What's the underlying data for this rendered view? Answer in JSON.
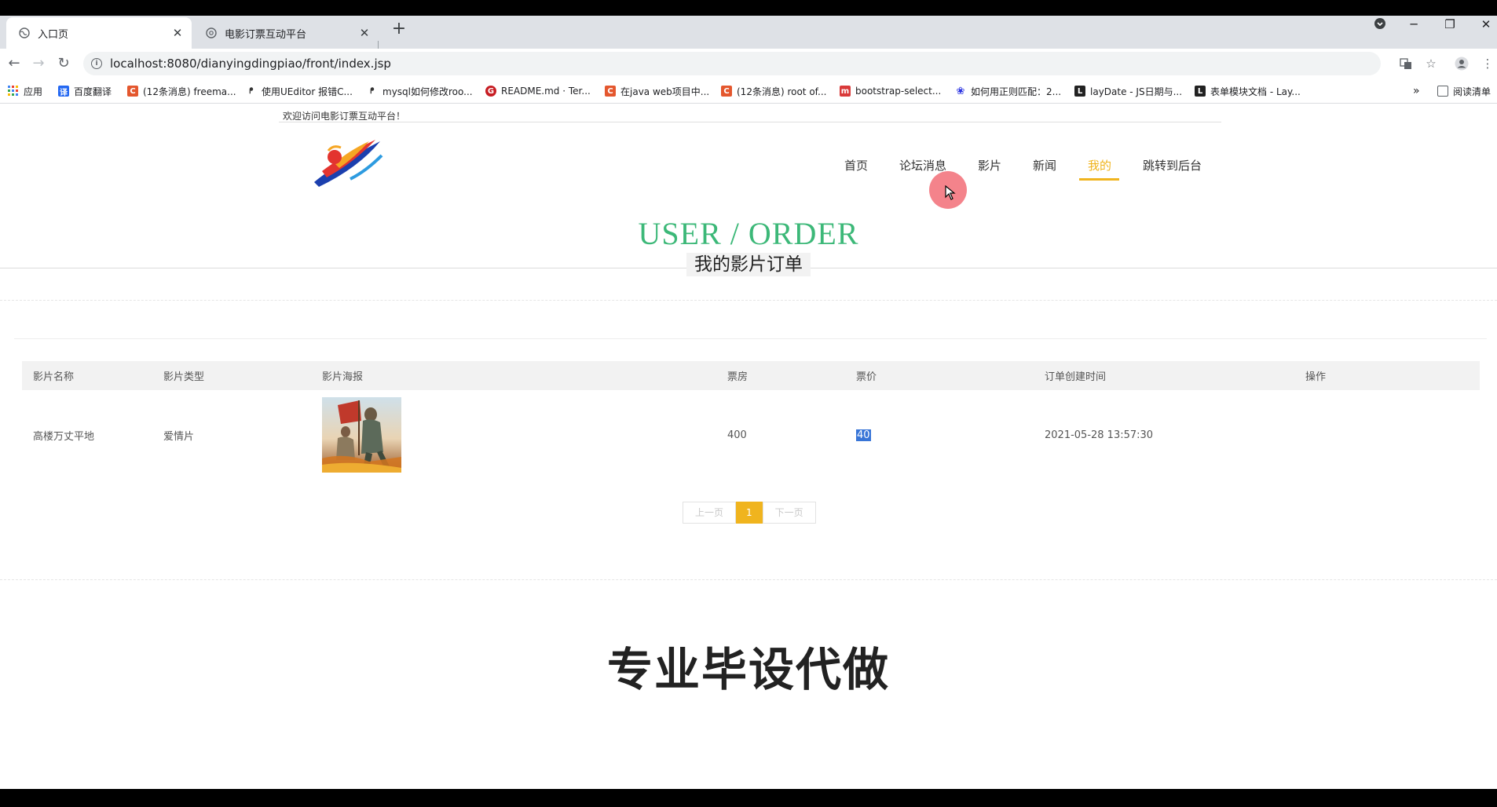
{
  "browser": {
    "tabs": [
      {
        "title": "入口页",
        "active": true
      },
      {
        "title": "电影订票互动平台",
        "active": false
      }
    ],
    "new_tab": "+",
    "url": "localhost:8080/dianyingdingpiao/front/index.jsp",
    "window_controls": {
      "minimize": "─",
      "restore": "❐",
      "close": "✕"
    },
    "bookmarks": [
      {
        "label": "应用",
        "icon": "apps-grid-icon",
        "color": "#4285f4"
      },
      {
        "label": "百度翻译",
        "icon": "baidu-translate-icon",
        "color": "#2468f2"
      },
      {
        "label": "(12条消息) freema...",
        "icon": "csdn-icon",
        "color": "#e4572e"
      },
      {
        "label": "使用UEditor 报错C...",
        "icon": "github-icon",
        "color": "#333333"
      },
      {
        "label": "mysql如何修改roo...",
        "icon": "github-icon",
        "color": "#333333"
      },
      {
        "label": "README.md · Ter...",
        "icon": "gitee-icon",
        "color": "#c71d23"
      },
      {
        "label": "在java web项目中...",
        "icon": "csdn-icon",
        "color": "#e4572e"
      },
      {
        "label": "(12条消息) root of...",
        "icon": "csdn-icon",
        "color": "#e4572e"
      },
      {
        "label": "bootstrap-select...",
        "icon": "m-icon",
        "color": "#d93a3a"
      },
      {
        "label": "如何用正则匹配：2...",
        "icon": "baidu-paw-icon",
        "color": "#2932e1"
      },
      {
        "label": "layDate - JS日期与...",
        "icon": "layui-icon",
        "color": "#222222"
      },
      {
        "label": "表单模块文档 - Lay...",
        "icon": "layui-icon",
        "color": "#222222"
      }
    ],
    "more_bookmarks": "»",
    "reading_list": "阅读清单"
  },
  "site": {
    "welcome": "欢迎访问电影订票互动平台！",
    "nav": [
      {
        "label": "首页",
        "active": false
      },
      {
        "label": "论坛消息",
        "active": false
      },
      {
        "label": "影片",
        "active": false
      },
      {
        "label": "新闻",
        "active": false
      },
      {
        "label": "我的",
        "active": true
      },
      {
        "label": "跳转到后台",
        "active": false
      }
    ],
    "accent_color": "#f0b41e",
    "title_en": "USER / ORDER",
    "title_en_color": "#3cb878",
    "title_cn": "我的影片订单"
  },
  "orders": {
    "columns": [
      "影片名称",
      "影片类型",
      "影片海报",
      "票房",
      "票价",
      "订单创建时间",
      "操作"
    ],
    "rows": [
      {
        "name": "高楼万丈平地",
        "type": "爱情片",
        "poster": "movie-poster-image",
        "box_office": "400",
        "price": "40",
        "created": "2021-05-28 13:57:30",
        "action": ""
      }
    ]
  },
  "pagination": {
    "prev": "上一页",
    "current": "1",
    "next": "下一页"
  },
  "overlay": {
    "watermark": "专业毕设代做"
  }
}
